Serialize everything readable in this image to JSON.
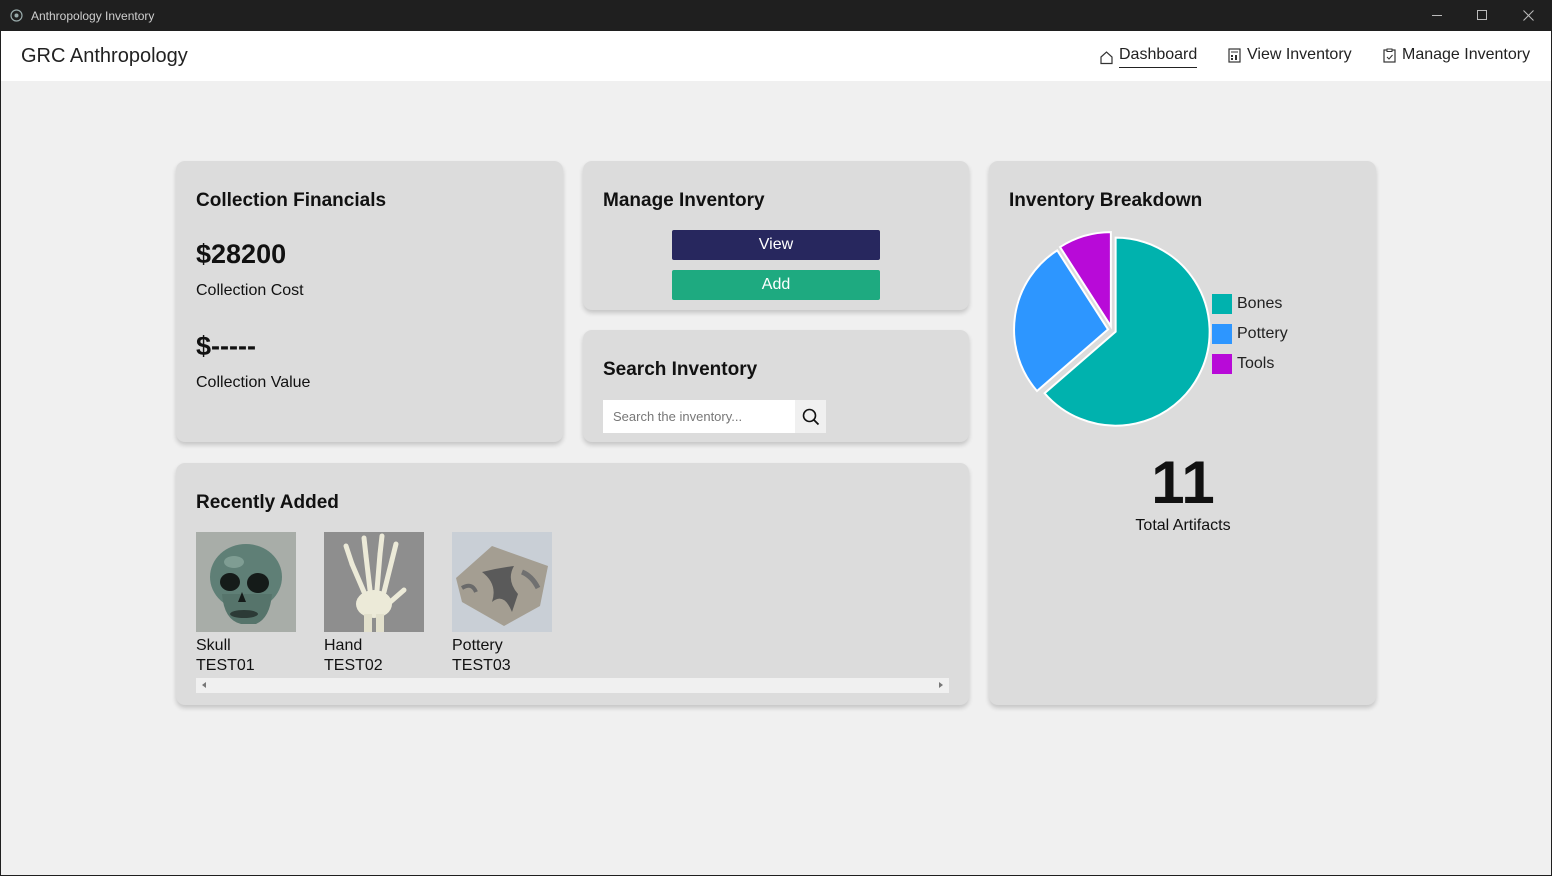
{
  "window": {
    "title": "Anthropology Inventory"
  },
  "navbar": {
    "brand": "GRC Anthropology",
    "items": [
      {
        "label": "Dashboard",
        "icon": "home-icon",
        "active": true
      },
      {
        "label": "View Inventory",
        "icon": "calculator-icon",
        "active": false
      },
      {
        "label": "Manage Inventory",
        "icon": "clipboard-icon",
        "active": false
      }
    ]
  },
  "financials": {
    "title": "Collection Financials",
    "cost_value": "$28200",
    "cost_label": "Collection Cost",
    "value_value": "$-----",
    "value_label": "Collection Value"
  },
  "manage": {
    "title": "Manage Inventory",
    "view_label": "View",
    "add_label": "Add"
  },
  "search": {
    "title": "Search Inventory",
    "placeholder": "Search the inventory..."
  },
  "recent": {
    "title": "Recently Added",
    "items": [
      {
        "name": "Skull",
        "id": "TEST01"
      },
      {
        "name": "Hand",
        "id": "TEST02"
      },
      {
        "name": "Pottery",
        "id": "TEST03"
      }
    ]
  },
  "breakdown": {
    "title": "Inventory Breakdown",
    "total": "11",
    "total_label": "Total Artifacts"
  },
  "chart_data": {
    "type": "pie",
    "labels": [
      "Bones",
      "Pottery",
      "Tools"
    ],
    "values": [
      7,
      3,
      1
    ],
    "colors": [
      "#00b2ae",
      "#2d96ff",
      "#b80ad8"
    ]
  }
}
